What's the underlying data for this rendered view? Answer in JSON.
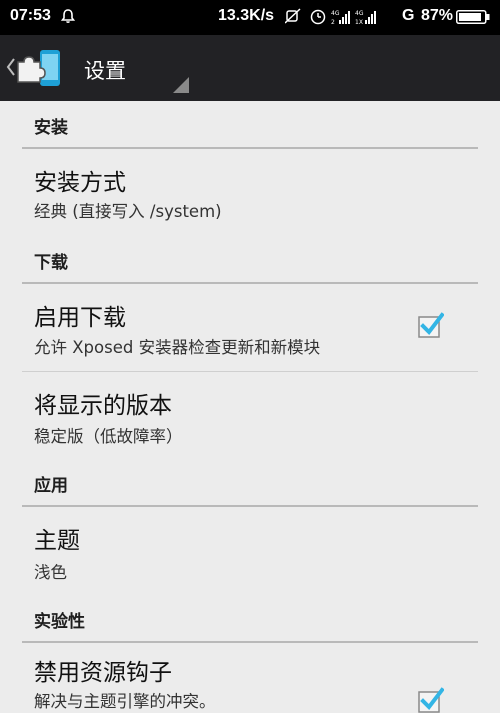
{
  "status_bar": {
    "time": "07:53",
    "net_speed": "13.3K/s",
    "battery_percent": "87%",
    "network_type": "G",
    "icons": [
      "notification-bell-icon",
      "mute-icon",
      "alarm-icon",
      "signal-4g-icon",
      "signal-4g-icon",
      "battery-icon"
    ]
  },
  "action_bar": {
    "title": "设置",
    "icon": "xposed-puzzle-icon"
  },
  "settings": {
    "cat_install": "安装",
    "install_method": {
      "title": "安装方式",
      "summary": "经典 (直接写入 /system)"
    },
    "cat_download": "下载",
    "enable_download": {
      "title": "启用下载",
      "summary": "允许 Xposed 安装器检查更新和新模块",
      "checked": true
    },
    "display_version": {
      "title": "将显示的版本",
      "summary": "稳定版（低故障率）"
    },
    "cat_app": "应用",
    "theme": {
      "title": "主题",
      "summary": "浅色"
    },
    "cat_experimental": "实验性",
    "disable_resources": {
      "title": "禁用资源钩子",
      "summary": "解决与主题引擎的冲突。",
      "checked": true
    }
  },
  "colors": {
    "accent": "#33b5e5",
    "background": "#ececec",
    "action_bar": "#222225"
  }
}
